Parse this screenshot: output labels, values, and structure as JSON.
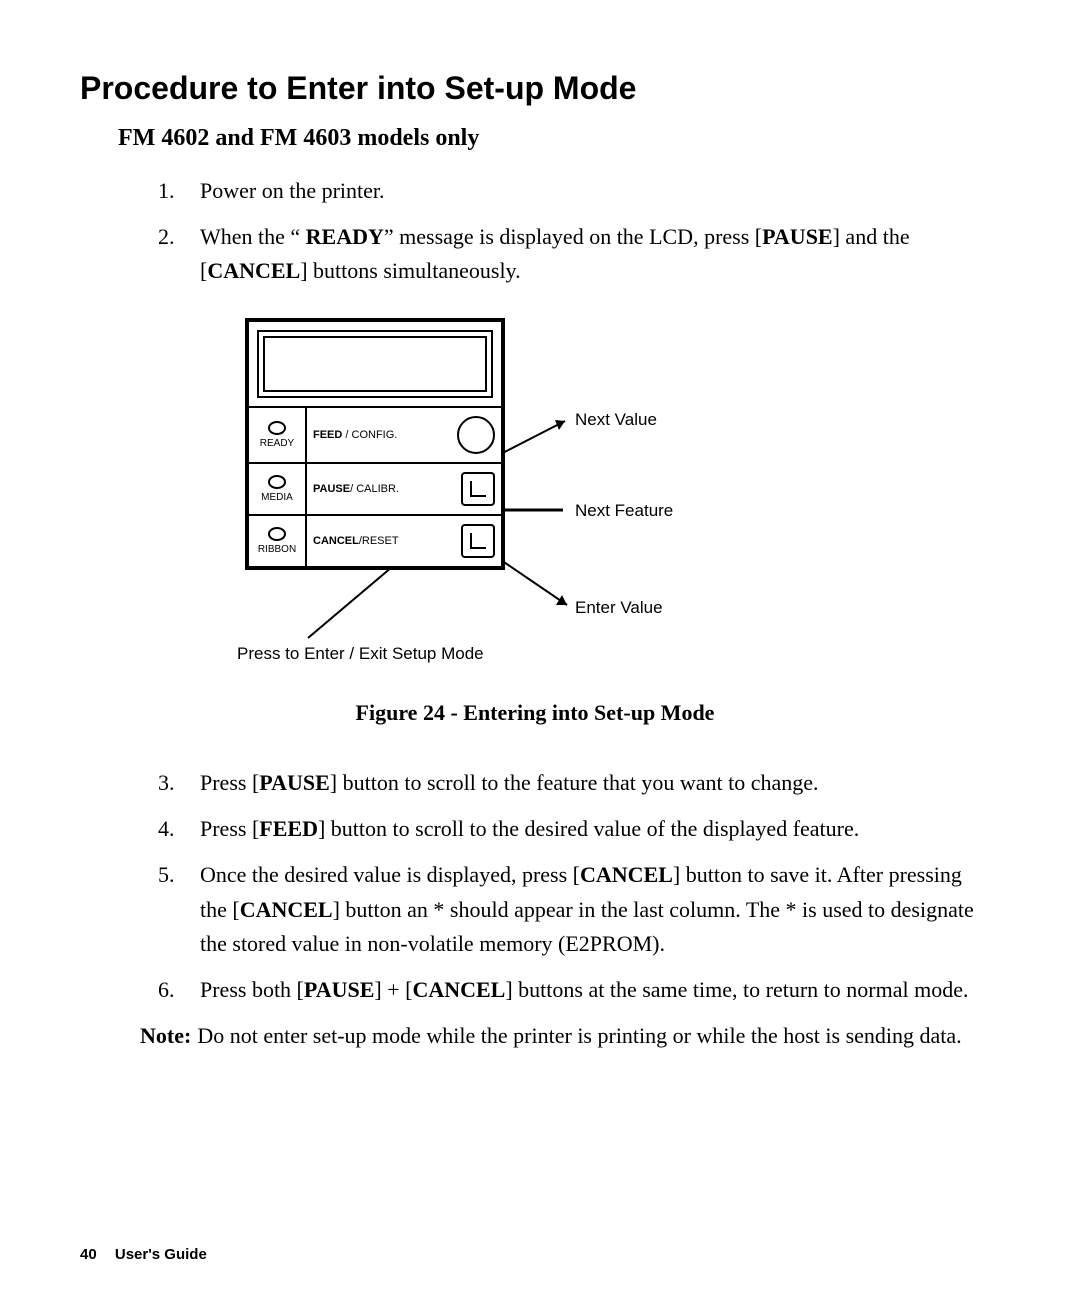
{
  "heading": "Procedure to Enter into Set-up Mode",
  "subheading": "FM 4602 and FM 4603 models only",
  "steps": {
    "s1_num": "1.",
    "s1": "Power on the printer.",
    "s2_num": "2.",
    "s2_a": "When the “ ",
    "s2_b": "READY",
    "s2_c": "” message is displayed on the LCD, press [",
    "s2_d": "PAUSE",
    "s2_e": "] and the [",
    "s2_f": "CANCEL",
    "s2_g": "] buttons simultaneously.",
    "s3_num": "3.",
    "s3_a": "Press [",
    "s3_b": "PAUSE",
    "s3_c": "] button to scroll to the feature that you want to change.",
    "s4_num": "4.",
    "s4_a": "Press [",
    "s4_b": "FEED",
    "s4_c": "] button to scroll to the desired value of the displayed feature.",
    "s5_num": "5.",
    "s5_a": "Once the desired value is displayed, press [",
    "s5_b": "CANCEL",
    "s5_c": "] button to save it.  After pressing the [",
    "s5_d": "CANCEL",
    "s5_e": "] button an * should appear in the last column.  The * is used to designate the stored value in non-volatile memory (E2PROM).",
    "s6_num": "6.",
    "s6_a": "Press both [",
    "s6_b": "PAUSE",
    "s6_c": "] + [",
    "s6_d": "CANCEL",
    "s6_e": "] buttons at the same time, to return to normal mode."
  },
  "diagram": {
    "ready": "READY",
    "media": "MEDIA",
    "ribbon": "RIBBON",
    "feed_bold": "FEED",
    "feed_rest": " / CONFIG.",
    "pause_bold": "PAUSE",
    "pause_rest": "/ CALIBR.",
    "cancel_bold": "CANCEL",
    "cancel_rest": "/RESET",
    "callout_next_value": "Next Value",
    "callout_next_feature": "Next Feature",
    "callout_enter_value": "Enter Value",
    "callout_press": "Press to Enter / Exit Setup Mode"
  },
  "figure_caption": "Figure 24 - Entering into Set-up Mode",
  "note_label": "Note:",
  "note_body": "Do not enter set-up mode while the printer is printing or while the host is sending data.",
  "footer": {
    "page_number": "40",
    "doc_title": "User's Guide"
  }
}
